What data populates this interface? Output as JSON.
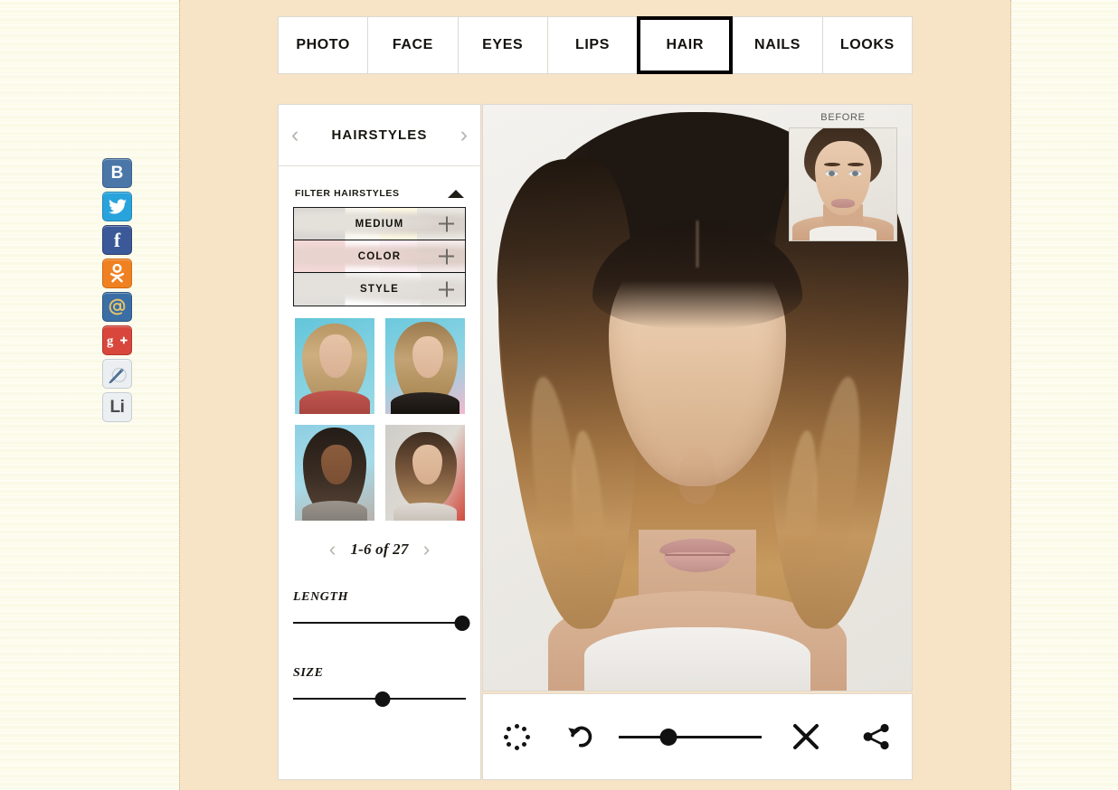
{
  "nav": {
    "tabs": [
      {
        "label": "PHOTO",
        "active": false
      },
      {
        "label": "FACE",
        "active": false
      },
      {
        "label": "EYES",
        "active": false
      },
      {
        "label": "LIPS",
        "active": false
      },
      {
        "label": "HAIR",
        "active": true
      },
      {
        "label": "NAILS",
        "active": false
      },
      {
        "label": "LOOKS",
        "active": false
      }
    ]
  },
  "social": {
    "items": [
      {
        "name": "vk-icon",
        "glyph": "B",
        "color": "#4a76a8"
      },
      {
        "name": "twitter-icon",
        "glyph": "",
        "color": "#29a3dc"
      },
      {
        "name": "facebook-icon",
        "glyph": "f",
        "color": "#3b5998"
      },
      {
        "name": "odnoklassniki-icon",
        "glyph": "",
        "color": "#f08122"
      },
      {
        "name": "mailru-icon",
        "glyph": "@",
        "color": "#3a6ea5"
      },
      {
        "name": "googleplus-icon",
        "glyph": "",
        "color": "#d8463c"
      },
      {
        "name": "livejournal-icon",
        "glyph": "",
        "color": "#eceff1"
      },
      {
        "name": "liveinternet-icon",
        "glyph": "Li",
        "color": "#eceff1"
      }
    ]
  },
  "panel": {
    "title": "HAIRSTYLES",
    "prev_arrow": "‹",
    "next_arrow": "›",
    "filter": {
      "label": "FILTER HAIRSTYLES",
      "rows": [
        {
          "label": "MEDIUM",
          "expand": "+"
        },
        {
          "label": "COLOR",
          "expand": "+"
        },
        {
          "label": "STYLE",
          "expand": "+"
        }
      ]
    },
    "thumbnails": [
      {
        "alt": "hairstyle-long-blonde-wavy"
      },
      {
        "alt": "hairstyle-side-swept-wavy"
      },
      {
        "alt": "hairstyle-straight-with-bangs"
      },
      {
        "alt": "hairstyle-ombre-bob"
      }
    ],
    "pagination": {
      "prev": "‹",
      "label": "1-6 of 27",
      "next": "›"
    },
    "sliders": [
      {
        "label": "LENGTH",
        "value": 98
      },
      {
        "label": "SIZE",
        "value": 52
      }
    ]
  },
  "photo": {
    "before_label": "BEFORE"
  },
  "toolbar": {
    "compare_icon": "dotted-circle-icon",
    "undo_icon": "undo-icon",
    "close_icon": "close-icon",
    "share_icon": "share-icon",
    "opacity_slider": {
      "value": 35
    }
  },
  "colors": {
    "page_bg": "#fdfbe9",
    "content_band": "#f7e3c6",
    "panel_bg": "#ffffff",
    "accent_border": "#000000",
    "photo_bg": "#f2f0ec"
  }
}
